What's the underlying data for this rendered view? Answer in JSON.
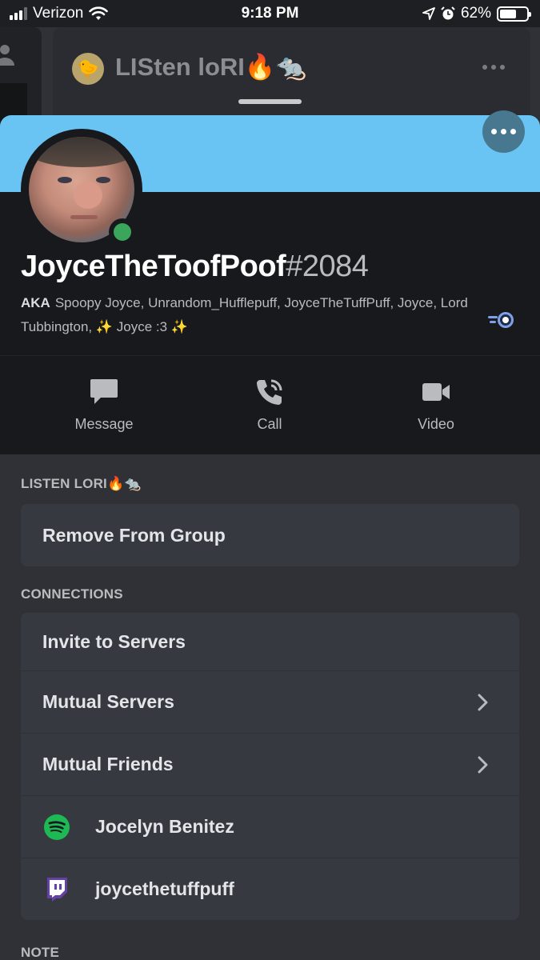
{
  "status_bar": {
    "carrier": "Verizon",
    "time": "9:18 PM",
    "battery": "62%",
    "battery_level": 0.62
  },
  "background": {
    "channel_title": "LISten loRI🔥🐀"
  },
  "profile": {
    "username": "JoyceTheToofPoof",
    "discriminator": "#2084",
    "aka_label": "AKA",
    "aka_names": "Spoopy Joyce, Unrandom_Hufflepuff, JoyceTheTuffPuff, Joyce, Lord Tubbington, ✨ Joyce :3 ✨",
    "status": "online"
  },
  "actions": [
    {
      "label": "Message",
      "icon": "message-icon"
    },
    {
      "label": "Call",
      "icon": "phone-icon"
    },
    {
      "label": "Video",
      "icon": "video-camera-icon"
    }
  ],
  "group_section": {
    "label": "LISTEN LORI🔥🐀",
    "remove_label": "Remove From Group"
  },
  "connections": {
    "label": "CONNECTIONS",
    "invite_label": "Invite to Servers",
    "mutual_servers_label": "Mutual Servers",
    "mutual_friends_label": "Mutual Friends",
    "spotify_name": "Jocelyn Benitez",
    "twitch_name": "joycethetuffpuff"
  },
  "note_label": "NOTE",
  "colors": {
    "banner": "#6ac4f3",
    "online": "#3ba55c",
    "spotify": "#1db954",
    "twitch": "#6441a5"
  }
}
